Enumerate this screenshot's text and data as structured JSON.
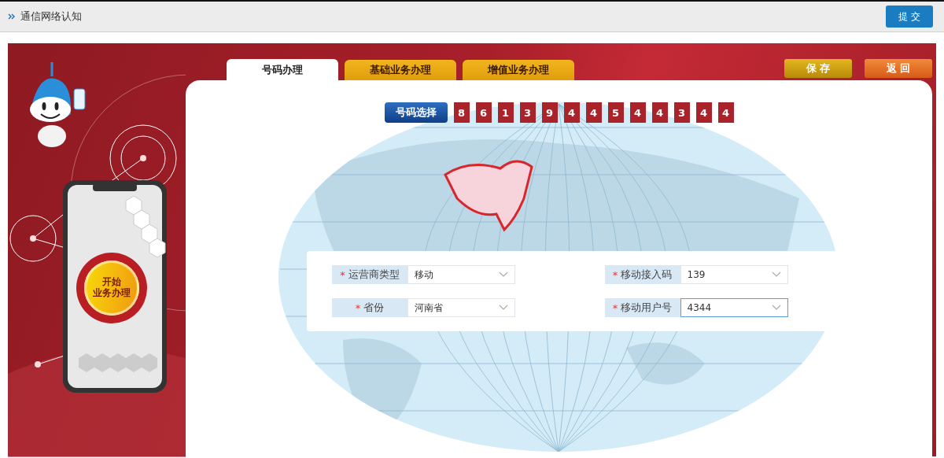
{
  "header": {
    "title": "通信网络认知",
    "submit": "提 交"
  },
  "start_button": {
    "lines": [
      "开始",
      "业务办理"
    ]
  },
  "tabs": [
    {
      "label": "号码办理",
      "selected": true
    },
    {
      "label": "基础业务办理",
      "selected": false
    },
    {
      "label": "增值业务办理",
      "selected": false
    }
  ],
  "actions": [
    {
      "label": "保 存",
      "kind": "save"
    },
    {
      "label": "返 回",
      "kind": "back"
    }
  ],
  "number_select": {
    "label": "号码选择",
    "digits": [
      "8",
      "6",
      "1",
      "3",
      "9",
      "4",
      "4",
      "5",
      "4",
      "4",
      "3",
      "4",
      "4"
    ]
  },
  "form": [
    {
      "mark": "*",
      "label": "运营商类型",
      "value": "移动",
      "focused": false
    },
    {
      "mark": "*",
      "label": "移动接入码",
      "value": "139",
      "focused": false
    },
    {
      "mark": "*",
      "label": "省份",
      "value": "河南省",
      "focused": false
    },
    {
      "mark": "*",
      "label": "移动用户号",
      "value": "4344",
      "focused": true
    }
  ]
}
